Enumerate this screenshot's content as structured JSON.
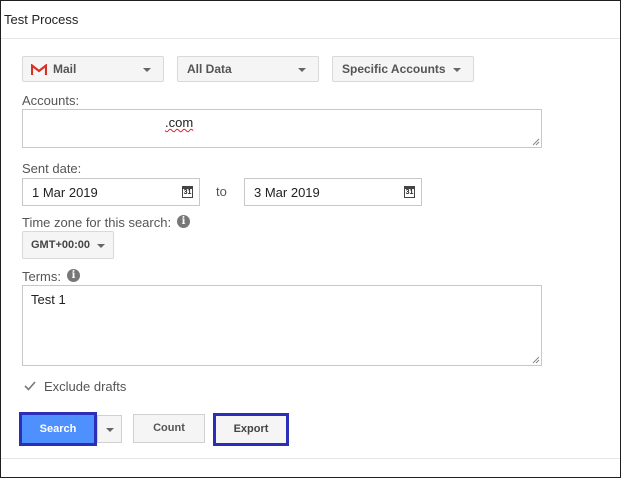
{
  "window": {
    "title": "Test Process"
  },
  "filters": {
    "service": {
      "label": "Mail",
      "icon": "gmail-icon"
    },
    "data_scope": {
      "label": "All Data"
    },
    "entity": {
      "label": "Specific Accounts"
    }
  },
  "accounts": {
    "label": "Accounts:",
    "value": ".com"
  },
  "sent_date": {
    "label": "Sent date:",
    "from": "1 Mar 2019",
    "to_label": "to",
    "to": "3 Mar 2019",
    "calendar_icon_text": "31"
  },
  "timezone": {
    "label": "Time zone for this search:",
    "value": "GMT+00:00",
    "info_icon": "i"
  },
  "terms": {
    "label": "Terms:",
    "value": "Test 1",
    "info_icon": "i"
  },
  "options": {
    "exclude_drafts_label": "Exclude drafts",
    "exclude_drafts_checked": true
  },
  "actions": {
    "search": "Search",
    "count": "Count",
    "export": "Export"
  },
  "colors": {
    "primary": "#4d90fe",
    "highlight": "#2b2fb8",
    "gmail_red": "#d93025"
  }
}
